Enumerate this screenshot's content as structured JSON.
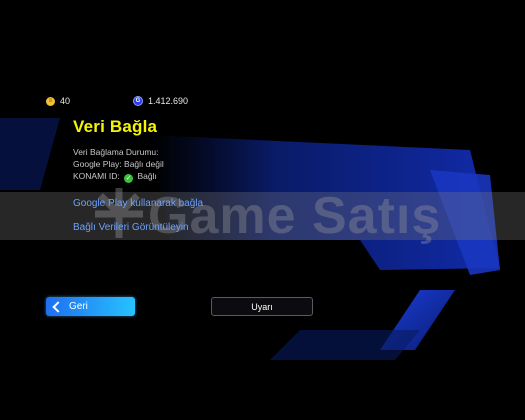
{
  "currency": {
    "coins": "40",
    "gp": "1.412.690"
  },
  "screen": {
    "title": "Veri Bağla",
    "status_heading": "Veri Bağlama Durumu:",
    "google_play_status": "Google Play: Bağlı değil",
    "konami_label": "KONAMI ID:",
    "konami_status": "Bağlı"
  },
  "links": {
    "google_play_link": "Google Play kullanarak bağla",
    "view_linked_data": "Bağlı Verileri Görüntüleyin"
  },
  "buttons": {
    "back": "Geri",
    "warning": "Uyarı"
  },
  "watermark": {
    "text": "Game Satış"
  },
  "colors": {
    "title": "#f5f500",
    "link": "#6aa2ff",
    "accent": "#27c2ff"
  }
}
